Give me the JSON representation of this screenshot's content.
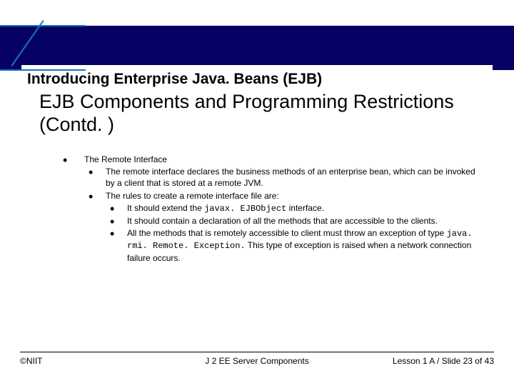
{
  "header": {
    "title": "Introducing Enterprise Java. Beans (EJB)"
  },
  "content": {
    "heading": "EJB Components and Programming Restrictions (Contd. )",
    "bullet1_title": "The Remote Interface",
    "sub1": "The remote interface declares the business methods of an enterprise bean, which can be invoked by a client that is stored at a remote JVM.",
    "sub2": "The rules to create a remote interface file are:",
    "rule1_a": "It should extend the ",
    "rule1_code": "javax. EJBObject",
    "rule1_b": " interface.",
    "rule2": "It should contain a declaration of all the methods that are accessible to the clients.",
    "rule3_a": "All the methods that is remotely accessible to client must throw an exception of type ",
    "rule3_code": "java. rmi. Remote. Exception.",
    "rule3_b": " This type of exception is raised when a network connection failure occurs."
  },
  "footer": {
    "left": "©NIIT",
    "center": "J 2 EE Server Components",
    "right": "Lesson 1 A / Slide 23 of 43"
  }
}
